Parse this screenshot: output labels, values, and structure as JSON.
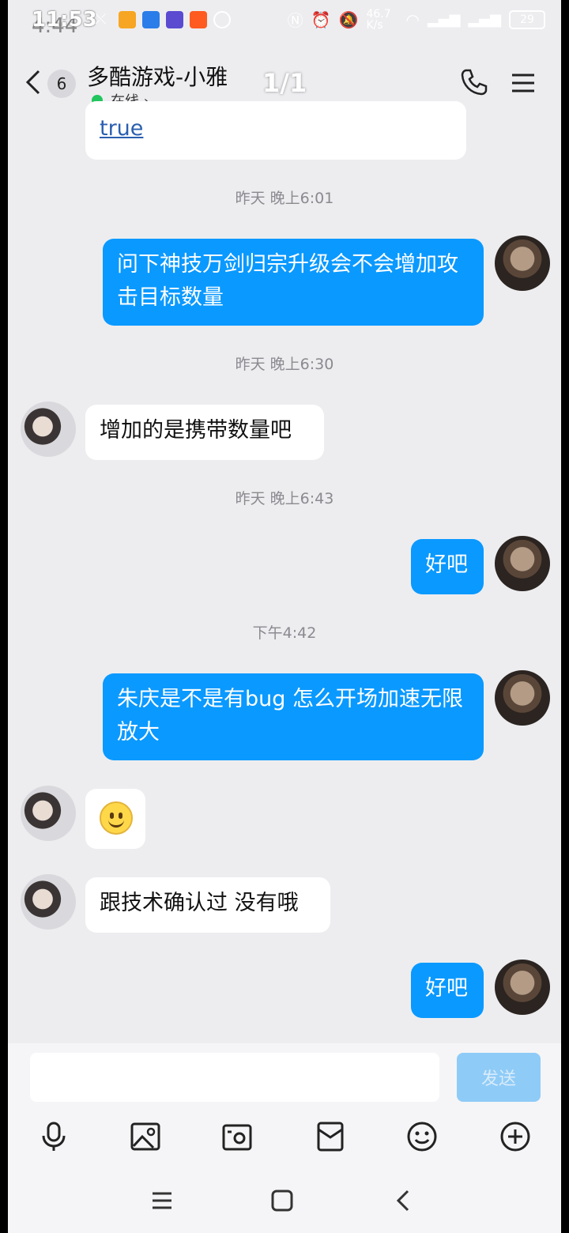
{
  "status_bar": {
    "time": "11:53",
    "time_shadow": "4:44",
    "network_speed": "46.7 K/s",
    "battery": "29"
  },
  "header": {
    "unread_count": "6",
    "title": "多酷游戏-小雅",
    "status": "在线 ›",
    "page_counter": "1/1"
  },
  "messages": {
    "partial_link": "true",
    "ts1": "昨天 晚上6:01",
    "m1": "问下神技万剑归宗升级会不会增加攻击目标数量",
    "ts2": "昨天 晚上6:30",
    "m2": "增加的是携带数量吧",
    "ts3": "昨天 晚上6:43",
    "m3": "好吧",
    "ts4": "下午4:42",
    "m4": "朱庆是不是有bug 怎么开场加速无限放大",
    "m6": "跟技术确认过 没有哦",
    "m7": "好吧"
  },
  "input": {
    "placeholder": "",
    "send_label": "发送"
  },
  "colors": {
    "outgoing_bubble": "#0a99ff",
    "incoming_bubble": "#ffffff",
    "background": "#ededf0",
    "send_button_disabled": "#8fcbf7"
  },
  "icons": {
    "toolbar": [
      "microphone-icon",
      "image-icon",
      "camera-icon",
      "red-packet-icon",
      "emoji-icon",
      "plus-icon"
    ],
    "navbar": [
      "menu-icon",
      "home-icon",
      "back-icon"
    ]
  }
}
